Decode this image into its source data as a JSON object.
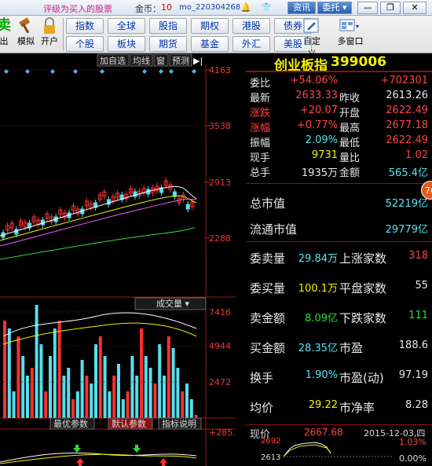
{
  "title": {
    "text": "评级为买入的股票",
    "coins_label": "金币：",
    "coins": "10",
    "user": "mo_220304268"
  },
  "titlebar_buttons": {
    "info": "资讯",
    "entrust": "委托"
  },
  "tools": [
    {
      "label": "出"
    },
    {
      "label": "模拟"
    },
    {
      "label": "开户"
    }
  ],
  "quick": [
    "指数",
    "全球",
    "股指",
    "期权",
    "港股",
    "债券",
    "个股",
    "板块",
    "期货",
    "基金",
    "外汇",
    "美股"
  ],
  "right_tools": [
    {
      "label": "自定义"
    },
    {
      "label": "多窗口"
    }
  ],
  "chart": {
    "header": [
      "加自选",
      "均线",
      "窗",
      "预测"
    ],
    "price_ticks": [
      "4163",
      "3538",
      "2913",
      "2288"
    ],
    "vol_label": "成交量",
    "vol_ticks": [
      "7416",
      "4944",
      "2472"
    ],
    "indicator_tabs": [
      "最优参数",
      "默认参数",
      "指标说明"
    ],
    "ind_tick": "+285.4"
  },
  "chart_data": {
    "type": "candlestick",
    "price_axis": [
      2288,
      4163
    ],
    "volume_axis": [
      0,
      7416
    ]
  },
  "header": {
    "name": "创业板指",
    "code": "399006"
  },
  "quote": {
    "weibi_l": "委比",
    "weibi": "+54.06%",
    "weicha": "+702301",
    "zuixin_l": "最新",
    "zuixin": "2633.33",
    "zuoshou_l": "昨收",
    "zuoshou": "2613.26",
    "zhangdie_l": "涨跌",
    "zhangdie": "+20.07",
    "kaipan_l": "开盘",
    "kaipan": "2622.49",
    "zhangfu_l": "涨幅",
    "zhangfu": "+0.77%",
    "zuigao_l": "最高",
    "zuigao": "2677.18",
    "zhenfu_l": "振幅",
    "zhenfu": "2.09%",
    "zuidi_l": "最低",
    "zuidi": "2622.49",
    "xianshou_l": "现手",
    "xianshou": "9731",
    "liangbi_l": "量比",
    "liangbi": "1.02",
    "zongshou_l": "总手",
    "zongshou": "1935万",
    "jine_l": "金额",
    "jine": "565.4亿"
  },
  "stats": {
    "zsz_l": "总市值",
    "zsz": "52219亿",
    "ltsz_l": "流通市值",
    "ltsz": "29779亿",
    "wmai_l": "委卖量",
    "wmai": "29.84万",
    "szjs_l": "上涨家数",
    "szjs": "318",
    "wmr_l": "委买量",
    "wmr": "100.1万",
    "ppjs_l": "平盘家数",
    "ppjs": "55",
    "mcje_l": "卖金额",
    "mcje": "8.09亿",
    "xdjs_l": "下跌家数",
    "xdjs": "111",
    "mrje_l": "买金额",
    "mrje": "28.35亿",
    "sy_l": "市盈",
    "sy": "188.6",
    "hs_l": "换手",
    "hs": "1.90%",
    "syd_l": "市盈(动)",
    "syd": "97.19",
    "jj_l": "均价",
    "jj": "29.22",
    "sjl_l": "市净率",
    "sjl": "8.28"
  },
  "bottom": {
    "xj_l": "现价",
    "xj": "2667.68",
    "date": "2015-12-03,四",
    "p1": "2692",
    "p2": "2613",
    "pct1": "1.03%",
    "pct2": "0.00%"
  },
  "badge": "76"
}
